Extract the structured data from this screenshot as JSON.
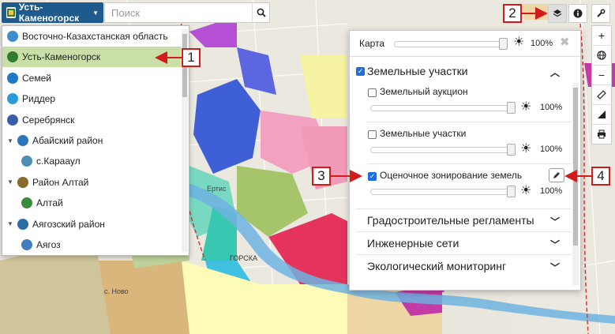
{
  "city_button": {
    "label": "Усть-Каменогорск"
  },
  "search": {
    "placeholder": "Поиск"
  },
  "dropdown": {
    "items": [
      {
        "label": "Восточно-Казахстанская область",
        "level": 0,
        "color": "#3f8ecb",
        "selected": false,
        "expandable": false
      },
      {
        "label": "Усть-Каменогорск",
        "level": 0,
        "color": "#2e7d32",
        "selected": true,
        "expandable": false
      },
      {
        "label": "Семей",
        "level": 0,
        "color": "#1f78c4",
        "selected": false,
        "expandable": false
      },
      {
        "label": "Риддер",
        "level": 0,
        "color": "#2a9bd6",
        "selected": false,
        "expandable": false
      },
      {
        "label": "Серебрянск",
        "level": 0,
        "color": "#3a5ea8",
        "selected": false,
        "expandable": false
      },
      {
        "label": "Абайский район",
        "level": 0,
        "color": "#2f76b8",
        "selected": false,
        "expandable": true
      },
      {
        "label": "с.Карааул",
        "level": 1,
        "color": "#4c8fb5",
        "selected": false,
        "expandable": false
      },
      {
        "label": "Район Алтай",
        "level": 0,
        "color": "#8a6a2b",
        "selected": false,
        "expandable": true
      },
      {
        "label": "Алтай",
        "level": 1,
        "color": "#3c8b3c",
        "selected": false,
        "expandable": false
      },
      {
        "label": "Аягозский район",
        "level": 0,
        "color": "#2e6da4",
        "selected": false,
        "expandable": true
      },
      {
        "label": "Аягоз",
        "level": 1,
        "color": "#3f7dbf",
        "selected": false,
        "expandable": false
      }
    ]
  },
  "top_controls": {
    "layers_icon": "layers-icon",
    "info_icon": "info-icon",
    "tools_icon": "tools-icon"
  },
  "side_controls": [
    "zoom-in-icon",
    "globe-icon",
    "zoom-out-icon",
    "ruler-icon",
    "area-measure-icon",
    "print-icon"
  ],
  "panel": {
    "base": {
      "label": "Карта",
      "opacity": "100%"
    },
    "group_title": "Земельные участки",
    "layers": [
      {
        "label": "Земельный аукцион",
        "checked": false,
        "opacity": "100%",
        "editable": false
      },
      {
        "label": "Земельные участки",
        "checked": false,
        "opacity": "100%",
        "editable": false
      },
      {
        "label": "Оценочное зонирование земель",
        "checked": true,
        "opacity": "100%",
        "editable": true
      }
    ],
    "groups": [
      {
        "label": "Градостроительные регламенты"
      },
      {
        "label": "Инженерные сети"
      },
      {
        "label": "Экологический мониторинг"
      }
    ]
  },
  "map": {
    "labels": [
      "Ертис",
      "ГОРСКА",
      "с. Ново"
    ]
  },
  "callouts": [
    "1",
    "2",
    "3",
    "4"
  ]
}
